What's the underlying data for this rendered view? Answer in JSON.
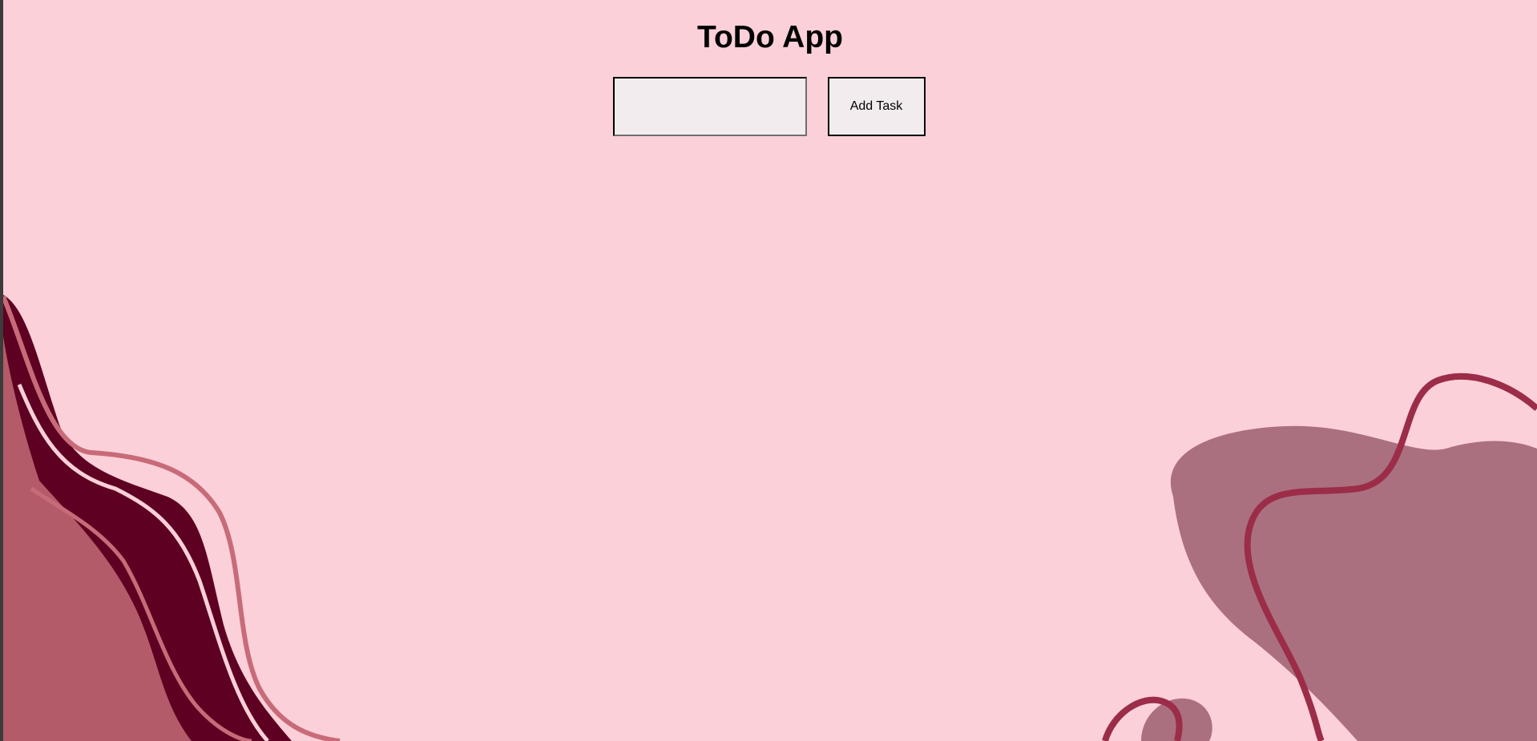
{
  "app": {
    "title": "ToDo App"
  },
  "task_form": {
    "input_value": "",
    "input_placeholder": "",
    "add_button_label": "Add Task"
  },
  "theme": {
    "background": "#fbd0d9",
    "wave_dark": "#5e0022",
    "wave_mid": "#b35b68",
    "wave_line": "#c86b79",
    "blob": "#ab707f",
    "blob_line": "#9b2d48"
  }
}
